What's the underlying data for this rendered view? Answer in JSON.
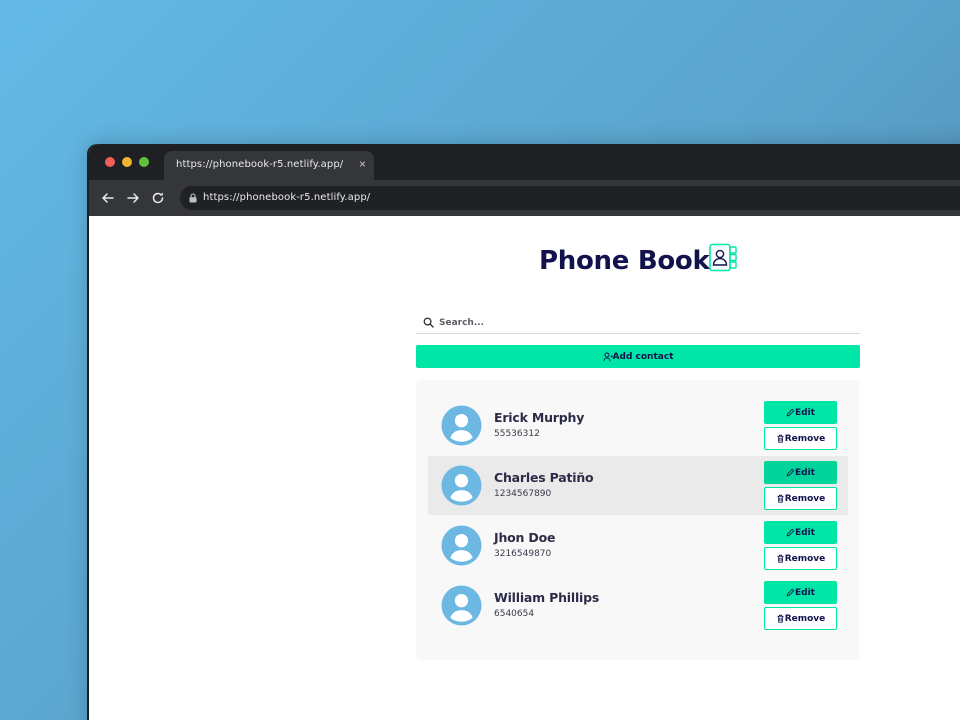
{
  "browser": {
    "tab_title": "https://phonebook-r5.netlify.app/",
    "tab_close": "×",
    "url": "https://phonebook-r5.netlify.app/"
  },
  "page": {
    "title": "Phone Book",
    "title_icon": "contact-book-icon",
    "search": {
      "placeholder": "Search...",
      "value": ""
    },
    "add_contact_label": "Add contact"
  },
  "contacts": [
    {
      "name": "Erick Murphy",
      "phone": "55536312",
      "edit_label": "Edit",
      "remove_label": "Remove"
    },
    {
      "name": "Charles Patiño",
      "phone": "1234567890",
      "edit_label": "Edit",
      "remove_label": "Remove"
    },
    {
      "name": "Jhon Doe",
      "phone": "3216549870",
      "edit_label": "Edit",
      "remove_label": "Remove"
    },
    {
      "name": "William Phillips",
      "phone": "6540654",
      "edit_label": "Edit",
      "remove_label": "Remove"
    }
  ],
  "colors": {
    "accent": "#00e6a6",
    "title": "#12124d",
    "avatar": "#6cb8e2",
    "background_gradient": [
      "#63b9e6",
      "#4f84a8"
    ]
  }
}
